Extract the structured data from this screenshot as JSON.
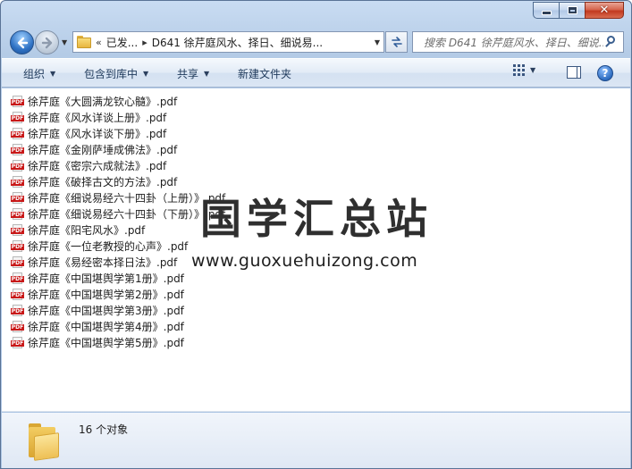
{
  "window": {
    "caption_buttons": [
      "minimize-icon",
      "maximize-icon",
      "close-icon"
    ]
  },
  "navigation": {
    "back_icon": "back-arrow-icon",
    "forward_icon": "forward-arrow-icon",
    "recent_dropdown_icon": "chevron-down-icon"
  },
  "address": {
    "icon": "folder-icon",
    "overflow": "«",
    "crumbs": [
      "已发...",
      "D641 徐芹庭风水、择日、细说易..."
    ],
    "separator": "▸",
    "dropdown": "▼"
  },
  "search": {
    "placeholder": "搜索 D641 徐芹庭风水、择日、细说..."
  },
  "toolbar": {
    "organize": "组织",
    "include_in_library": "包含到库中",
    "share": "共享",
    "new_folder": "新建文件夹",
    "dropdown_arrow": "▼",
    "help": "?"
  },
  "files": [
    {
      "name": "徐芹庭《大圆满龙钦心髓》.pdf",
      "icon": "pdf-icon"
    },
    {
      "name": "徐芹庭《风水详谈上册》.pdf",
      "icon": "pdf-icon"
    },
    {
      "name": "徐芹庭《风水详谈下册》.pdf",
      "icon": "pdf-icon"
    },
    {
      "name": "徐芹庭《金刚萨埵成佛法》.pdf",
      "icon": "pdf-icon"
    },
    {
      "name": "徐芹庭《密宗六成就法》.pdf",
      "icon": "pdf-icon"
    },
    {
      "name": "徐芹庭《破择古文的方法》.pdf",
      "icon": "pdf-icon"
    },
    {
      "name": "徐芹庭《细说易经六十四卦（上册）》.pdf",
      "icon": "pdf-icon"
    },
    {
      "name": "徐芹庭《细说易经六十四卦（下册）》.pdf",
      "icon": "pdf-icon"
    },
    {
      "name": "徐芹庭《阳宅风水》.pdf",
      "icon": "pdf-icon"
    },
    {
      "name": "徐芹庭《一位老教授的心声》.pdf",
      "icon": "pdf-icon"
    },
    {
      "name": "徐芹庭《易经密本择日法》.pdf",
      "icon": "pdf-icon"
    },
    {
      "name": "徐芹庭《中国堪舆学第1册》.pdf",
      "icon": "pdf-icon"
    },
    {
      "name": "徐芹庭《中国堪舆学第2册》.pdf",
      "icon": "pdf-icon"
    },
    {
      "name": "徐芹庭《中国堪舆学第3册》.pdf",
      "icon": "pdf-icon"
    },
    {
      "name": "徐芹庭《中国堪舆学第4册》.pdf",
      "icon": "pdf-icon"
    },
    {
      "name": "徐芹庭《中国堪舆学第5册》.pdf",
      "icon": "pdf-icon"
    }
  ],
  "file_icon_tag": "PDF",
  "watermark": {
    "logo": "国学汇总站",
    "url": "www.guoxuehuizong.com"
  },
  "status": {
    "icon": "folder-icon",
    "text": "16 个对象"
  },
  "colors": {
    "pdf_tag": "#c81818",
    "window_frame": "#b4cbe6",
    "close_button": "#c2391f"
  }
}
